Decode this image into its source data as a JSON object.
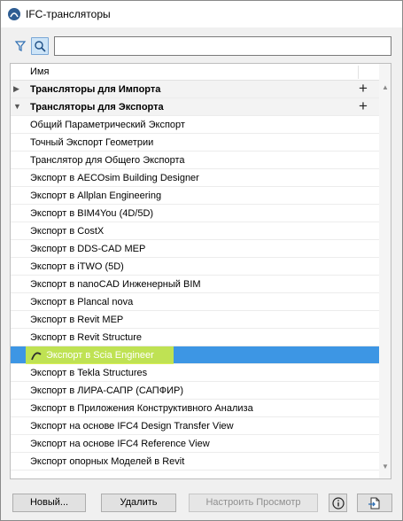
{
  "window": {
    "title": "IFC-трансляторы"
  },
  "toolbar": {
    "filter_icon": "filter-icon",
    "search_icon": "search-icon",
    "search_value": ""
  },
  "tree": {
    "column_name": "Имя",
    "groups": [
      {
        "label": "Трансляторы для Импорта",
        "expanded": false
      },
      {
        "label": "Трансляторы для Экспорта",
        "expanded": true
      }
    ],
    "items": [
      "Общий Параметрический Экспорт",
      "Точный Экспорт Геометрии",
      "Транслятор для Общего Экспорта",
      "Экспорт в AECOsim Building Designer",
      "Экспорт в Allplan Engineering",
      "Экспорт в BIM4You (4D/5D)",
      "Экспорт в CostX",
      "Экспорт в DDS-CAD MEP",
      "Экспорт в iTWO (5D)",
      "Экспорт в nanoCAD Инженерный BIM",
      "Экспорт в Plancal nova",
      "Экспорт в Revit MEP",
      "Экспорт в Revit Structure",
      "Экспорт в Scia Engineer",
      "Экспорт в Tekla Structures",
      "Экспорт в ЛИРА-САПР (САПФИР)",
      "Экспорт в Приложения Конструктивного Анализа",
      "Экспорт на основе IFC4 Design Transfer View",
      "Экспорт на основе IFC4 Reference View",
      "Экспорт опорных Моделей в Revit"
    ],
    "selected_item": "Экспорт в Scia Engineer"
  },
  "footer": {
    "new_label": "Новый...",
    "delete_label": "Удалить",
    "configure_label": "Настроить Просмотр",
    "info_icon": "info-icon",
    "export_icon": "export-file-icon"
  },
  "colors": {
    "selection": "#3d96e4",
    "highlight": "#d6f03a"
  }
}
